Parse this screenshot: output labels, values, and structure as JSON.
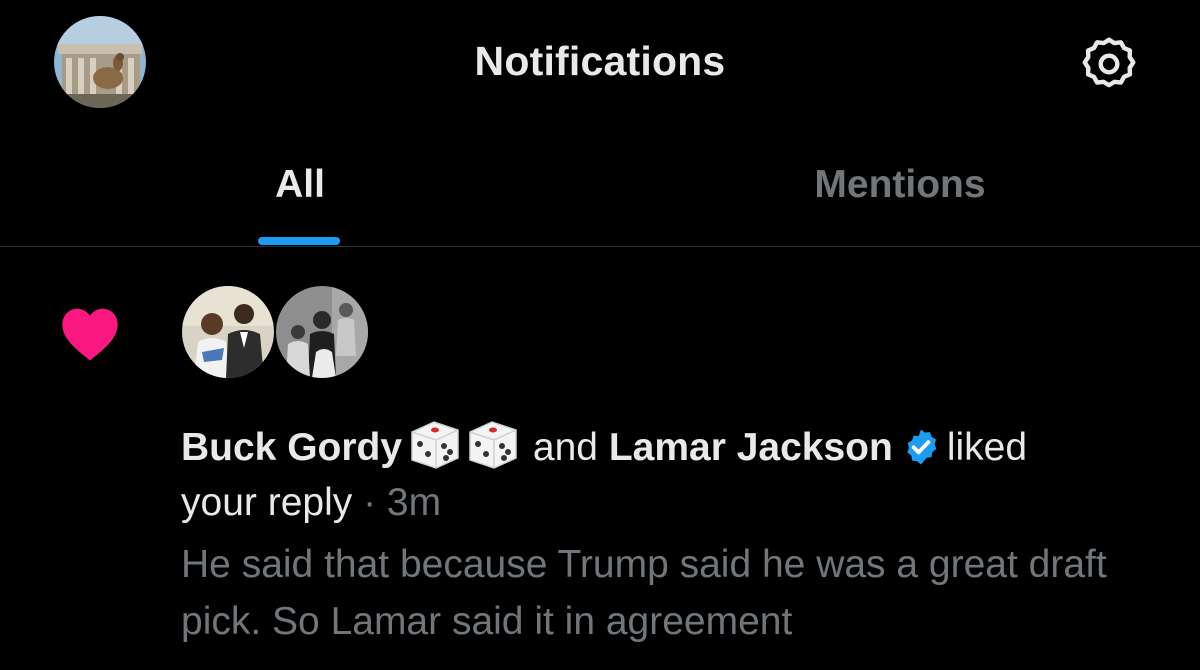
{
  "header": {
    "title": "Notifications",
    "avatar_icon": "profile-avatar-photo",
    "settings_icon": "gear-icon"
  },
  "tabs": [
    {
      "label": "All",
      "active": true
    },
    {
      "label": "Mentions",
      "active": false
    }
  ],
  "notification": {
    "type_icon": "heart-icon",
    "actors": [
      {
        "name": "Buck Gordy",
        "badge_icons": [
          "dice-icon",
          "dice-icon"
        ]
      },
      {
        "name": "Lamar Jackson",
        "badge_icons": [
          "verified-badge-icon"
        ]
      }
    ],
    "connector": "and",
    "action": "liked",
    "object": "your reply",
    "separator": "·",
    "time": "3m",
    "preview_text": "He said that because Trump said he was a great draft pick. So Lamar said it in agreement"
  },
  "colors": {
    "background": "#000000",
    "primary_text": "#e7e9ea",
    "secondary_text": "#71767b",
    "accent": "#1d9bf0",
    "like_pink": "#f91880",
    "divider": "#2f3336"
  }
}
